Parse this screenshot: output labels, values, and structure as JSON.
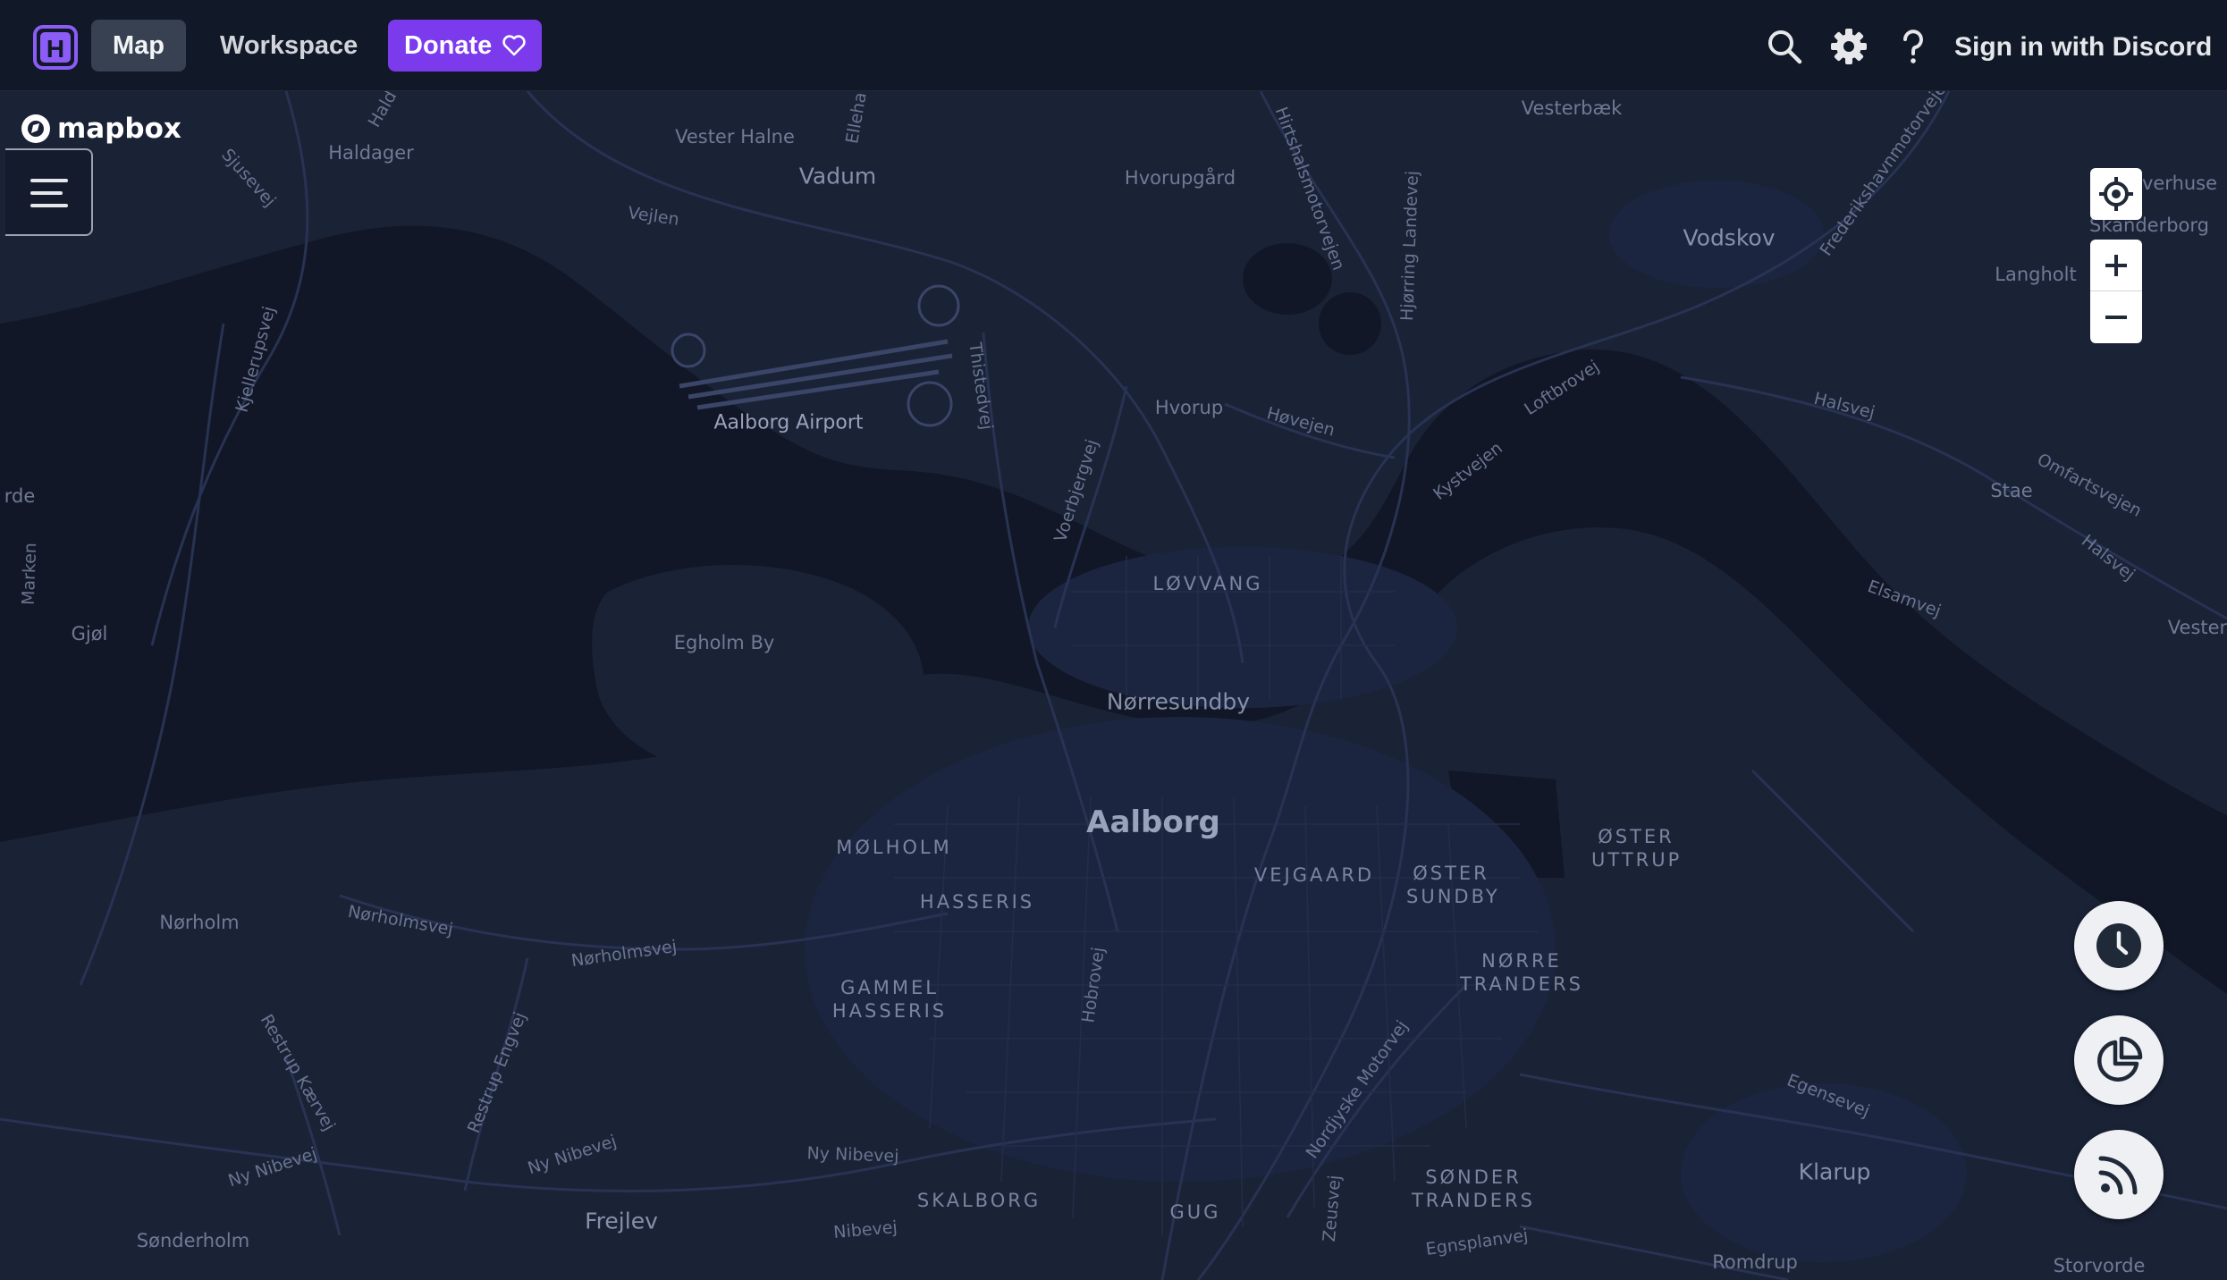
{
  "nav": {
    "map_label": "Map",
    "workspace_label": "Workspace",
    "donate_label": "Donate",
    "signin_label": "Sign in with Discord",
    "logo_letter": "H"
  },
  "map": {
    "attribution_logo": "mapbox",
    "places": {
      "city": [
        "Aalborg"
      ],
      "towns": [
        "Vadum",
        "Vodskov",
        "Nørresundby",
        "Klarup",
        "Frejlev"
      ],
      "villages": [
        "Vester Halne",
        "Haldager",
        "Hvorupgård",
        "Vesterbæk",
        "Langholt",
        "Hvorup",
        "Egholm By",
        "Gjøl",
        "Nørholm",
        "Sønderholm",
        "Stae",
        "Storvorde",
        "Romdrup",
        "Vester",
        "Skanderborg",
        "verhuse",
        "rde"
      ],
      "districts": [
        "LØVVANG",
        "MØLHOLM",
        "HASSERIS",
        "VEJGAARD",
        "ØSTER SUNDBY",
        "ØSTER UTTRUP",
        "NØRRE TRANDERS",
        "GAMMEL HASSERIS",
        "SKALBORG",
        "GUG",
        "SØNDER TRANDERS"
      ],
      "airport": "Aalborg Airport"
    },
    "roads": [
      "Sjusevej",
      "Hald",
      "Elleha",
      "Vejlen",
      "Hirtshalsmotorvejen",
      "Hjørring Landevej",
      "Frederikshavnmotorvejen",
      "Kjellerupsvej",
      "Thistedvej",
      "Voerbjergvej",
      "Hvorup",
      "Høvejen",
      "Loftbrovej",
      "Kystvejen",
      "Halsvej",
      "Omfartsvejen",
      "Elsamvej",
      "Marken",
      "Nørholmsvej",
      "Restrup Kærvej",
      "Restrup Engvej",
      "Ny Nibevej",
      "Nibevej",
      "Hobrovej",
      "Nordjyske Motorvej",
      "Zeusvej",
      "Egnsplanvej",
      "Egensevej"
    ],
    "controls": {
      "locate_icon": "crosshair-icon",
      "zoom_in_icon": "plus-icon",
      "zoom_out_icon": "minus-icon"
    },
    "fabs": [
      "clock-icon",
      "pie-chart-icon",
      "rss-icon"
    ]
  },
  "colors": {
    "topbar_bg": "#111827",
    "active_tab_bg": "#374151",
    "donate_bg": "#7c3aed",
    "logo_accent": "#8b5cf6",
    "land": "#1a2236",
    "water": "#111726"
  }
}
